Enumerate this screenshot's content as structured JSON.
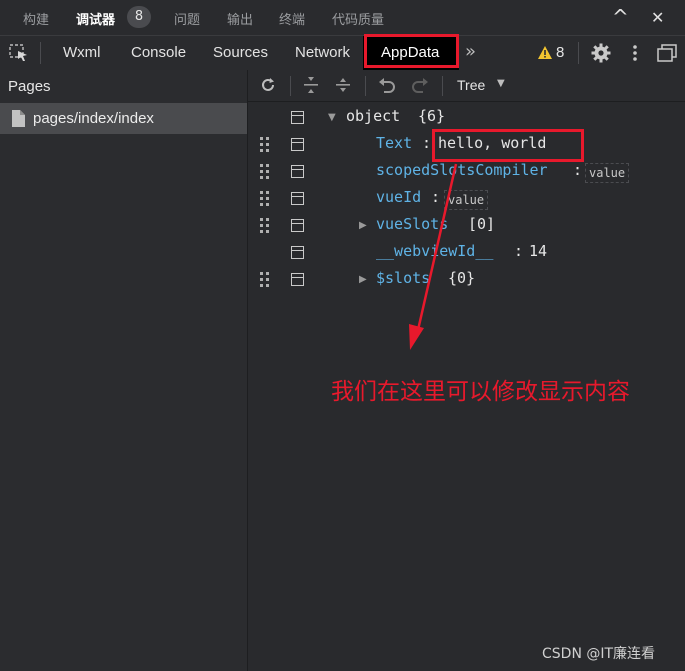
{
  "top_tabs": [
    {
      "label": "构建"
    },
    {
      "label": "调试器",
      "active": true
    },
    {
      "label": "问题"
    },
    {
      "label": "输出"
    },
    {
      "label": "终端"
    },
    {
      "label": "代码质量"
    }
  ],
  "debugger_badge": "8",
  "window_buttons": {
    "collapse": "^",
    "close": "✕"
  },
  "tool_tabs": [
    {
      "label": "Wxml"
    },
    {
      "label": "Console"
    },
    {
      "label": "Sources"
    },
    {
      "label": "Network"
    },
    {
      "label": "AppData",
      "active": true
    }
  ],
  "more_symbol": "»",
  "warning_count": "8",
  "pages_panel": {
    "title": "Pages",
    "items": [
      "pages/index/index"
    ]
  },
  "data_toolbar": {
    "view_mode": "Tree"
  },
  "tree": {
    "root": {
      "key": "object",
      "summary": "{6}"
    },
    "rows": [
      {
        "key": "Text",
        "value": "hello, world"
      },
      {
        "key": "scopedSlotsCompiler",
        "tag": "value"
      },
      {
        "key": "vueId",
        "tag": "value"
      },
      {
        "key": "vueSlots",
        "summary": "[0]"
      },
      {
        "key": "__webviewId__",
        "value": "14"
      },
      {
        "key": "$slots",
        "summary": "{0}"
      }
    ]
  },
  "annotation": "我们在这里可以修改显示内容",
  "watermark": "CSDN @IT廉连看",
  "colors": {
    "accent_red": "#e8192c",
    "key_blue": "#5fb3e6",
    "warning_yellow": "#f2c530"
  }
}
